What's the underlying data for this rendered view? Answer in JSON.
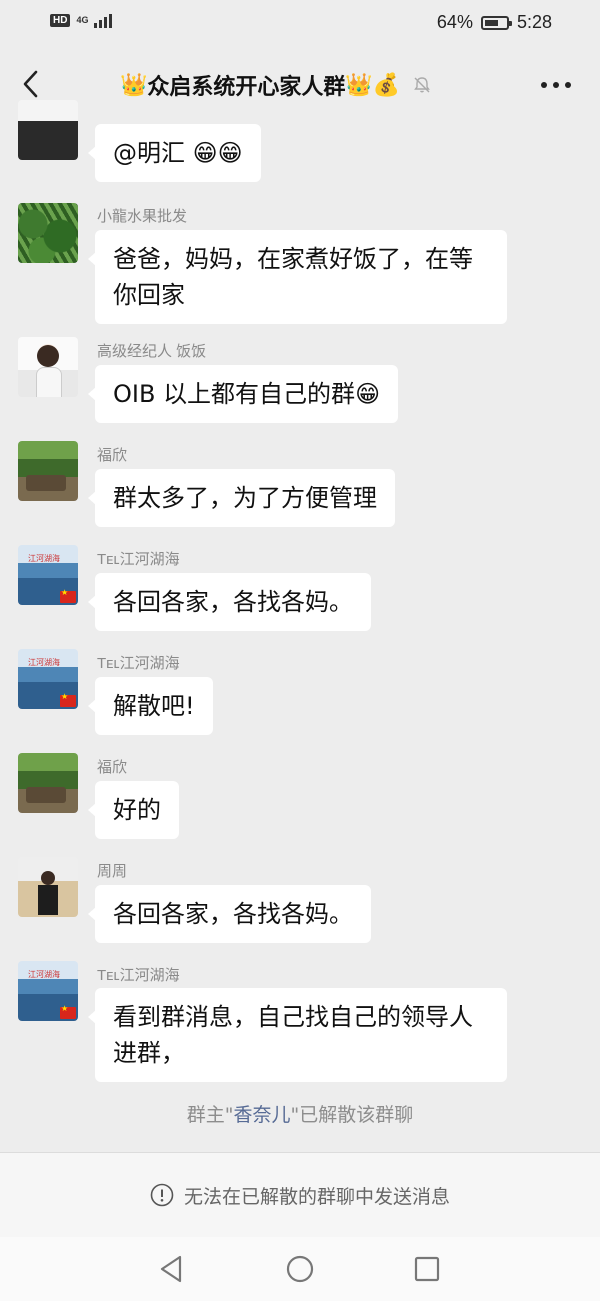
{
  "status_bar": {
    "hd": "HD",
    "network": "4G",
    "battery_text": "64%",
    "battery_level": 0.64,
    "time": "5:28"
  },
  "nav": {
    "title_prefix_emoji": "👑",
    "title": "众启系统开心家人群",
    "title_suffix_emoji": "👑💰",
    "back_icon": "chevron-left-icon",
    "mute_icon": "muted-bell-icon",
    "more_icon": "more-dots-icon"
  },
  "messages": [
    {
      "sender": "",
      "text": "@明汇 ",
      "emoji": "😁😁",
      "avatar": "suit"
    },
    {
      "sender": "小龍水果批发",
      "text": "爸爸，妈妈，在家煮好饭了，在等你回家",
      "lines": [
        "爸爸，妈妈，在家煮好饭了，在等",
        "你回家"
      ],
      "avatar": "melon"
    },
    {
      "sender": "高级经纪人 饭饭",
      "text": "OIB 以上都有自己的群",
      "emoji": "😁",
      "avatar": "woman"
    },
    {
      "sender": "福欣",
      "text": "群太多了，为了方便管理",
      "avatar": "forest"
    },
    {
      "sender": "Tᴇʟ江河湖海",
      "text": "各回各家，各找各妈。",
      "avatar": "sea"
    },
    {
      "sender": "Tᴇʟ江河湖海",
      "text": "解散吧!",
      "avatar": "sea"
    },
    {
      "sender": "福欣",
      "text": "好的",
      "avatar": "forest"
    },
    {
      "sender": "周周",
      "text": "各回各家，各找各妈。",
      "avatar": "office"
    },
    {
      "sender": "Tᴇʟ江河湖海",
      "text": "看到群消息，自己找自己的领导人进群，",
      "lines": [
        "看到群消息，自己找自己的领导人",
        "进群，"
      ],
      "avatar": "sea"
    }
  ],
  "system_notice": {
    "prefix": "群主\"",
    "owner": "香奈儿",
    "suffix": "\"已解散该群聊"
  },
  "input_bar": {
    "text": "无法在已解散的群聊中发送消息",
    "icon": "info-icon"
  },
  "android_nav": {
    "back": "triangle-back-icon",
    "home": "circle-home-icon",
    "recents": "square-recents-icon"
  }
}
